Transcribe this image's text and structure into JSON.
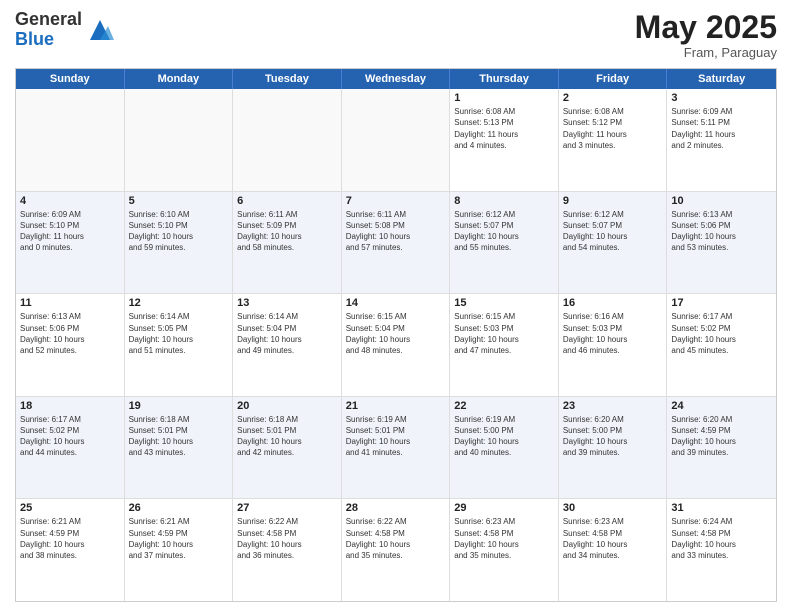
{
  "logo": {
    "general": "General",
    "blue": "Blue"
  },
  "title": "May 2025",
  "location": "Fram, Paraguay",
  "days_of_week": [
    "Sunday",
    "Monday",
    "Tuesday",
    "Wednesday",
    "Thursday",
    "Friday",
    "Saturday"
  ],
  "weeks": [
    [
      {
        "day": "",
        "info": ""
      },
      {
        "day": "",
        "info": ""
      },
      {
        "day": "",
        "info": ""
      },
      {
        "day": "",
        "info": ""
      },
      {
        "day": "1",
        "info": "Sunrise: 6:08 AM\nSunset: 5:13 PM\nDaylight: 11 hours\nand 4 minutes."
      },
      {
        "day": "2",
        "info": "Sunrise: 6:08 AM\nSunset: 5:12 PM\nDaylight: 11 hours\nand 3 minutes."
      },
      {
        "day": "3",
        "info": "Sunrise: 6:09 AM\nSunset: 5:11 PM\nDaylight: 11 hours\nand 2 minutes."
      }
    ],
    [
      {
        "day": "4",
        "info": "Sunrise: 6:09 AM\nSunset: 5:10 PM\nDaylight: 11 hours\nand 0 minutes."
      },
      {
        "day": "5",
        "info": "Sunrise: 6:10 AM\nSunset: 5:10 PM\nDaylight: 10 hours\nand 59 minutes."
      },
      {
        "day": "6",
        "info": "Sunrise: 6:11 AM\nSunset: 5:09 PM\nDaylight: 10 hours\nand 58 minutes."
      },
      {
        "day": "7",
        "info": "Sunrise: 6:11 AM\nSunset: 5:08 PM\nDaylight: 10 hours\nand 57 minutes."
      },
      {
        "day": "8",
        "info": "Sunrise: 6:12 AM\nSunset: 5:07 PM\nDaylight: 10 hours\nand 55 minutes."
      },
      {
        "day": "9",
        "info": "Sunrise: 6:12 AM\nSunset: 5:07 PM\nDaylight: 10 hours\nand 54 minutes."
      },
      {
        "day": "10",
        "info": "Sunrise: 6:13 AM\nSunset: 5:06 PM\nDaylight: 10 hours\nand 53 minutes."
      }
    ],
    [
      {
        "day": "11",
        "info": "Sunrise: 6:13 AM\nSunset: 5:06 PM\nDaylight: 10 hours\nand 52 minutes."
      },
      {
        "day": "12",
        "info": "Sunrise: 6:14 AM\nSunset: 5:05 PM\nDaylight: 10 hours\nand 51 minutes."
      },
      {
        "day": "13",
        "info": "Sunrise: 6:14 AM\nSunset: 5:04 PM\nDaylight: 10 hours\nand 49 minutes."
      },
      {
        "day": "14",
        "info": "Sunrise: 6:15 AM\nSunset: 5:04 PM\nDaylight: 10 hours\nand 48 minutes."
      },
      {
        "day": "15",
        "info": "Sunrise: 6:15 AM\nSunset: 5:03 PM\nDaylight: 10 hours\nand 47 minutes."
      },
      {
        "day": "16",
        "info": "Sunrise: 6:16 AM\nSunset: 5:03 PM\nDaylight: 10 hours\nand 46 minutes."
      },
      {
        "day": "17",
        "info": "Sunrise: 6:17 AM\nSunset: 5:02 PM\nDaylight: 10 hours\nand 45 minutes."
      }
    ],
    [
      {
        "day": "18",
        "info": "Sunrise: 6:17 AM\nSunset: 5:02 PM\nDaylight: 10 hours\nand 44 minutes."
      },
      {
        "day": "19",
        "info": "Sunrise: 6:18 AM\nSunset: 5:01 PM\nDaylight: 10 hours\nand 43 minutes."
      },
      {
        "day": "20",
        "info": "Sunrise: 6:18 AM\nSunset: 5:01 PM\nDaylight: 10 hours\nand 42 minutes."
      },
      {
        "day": "21",
        "info": "Sunrise: 6:19 AM\nSunset: 5:01 PM\nDaylight: 10 hours\nand 41 minutes."
      },
      {
        "day": "22",
        "info": "Sunrise: 6:19 AM\nSunset: 5:00 PM\nDaylight: 10 hours\nand 40 minutes."
      },
      {
        "day": "23",
        "info": "Sunrise: 6:20 AM\nSunset: 5:00 PM\nDaylight: 10 hours\nand 39 minutes."
      },
      {
        "day": "24",
        "info": "Sunrise: 6:20 AM\nSunset: 4:59 PM\nDaylight: 10 hours\nand 39 minutes."
      }
    ],
    [
      {
        "day": "25",
        "info": "Sunrise: 6:21 AM\nSunset: 4:59 PM\nDaylight: 10 hours\nand 38 minutes."
      },
      {
        "day": "26",
        "info": "Sunrise: 6:21 AM\nSunset: 4:59 PM\nDaylight: 10 hours\nand 37 minutes."
      },
      {
        "day": "27",
        "info": "Sunrise: 6:22 AM\nSunset: 4:58 PM\nDaylight: 10 hours\nand 36 minutes."
      },
      {
        "day": "28",
        "info": "Sunrise: 6:22 AM\nSunset: 4:58 PM\nDaylight: 10 hours\nand 35 minutes."
      },
      {
        "day": "29",
        "info": "Sunrise: 6:23 AM\nSunset: 4:58 PM\nDaylight: 10 hours\nand 35 minutes."
      },
      {
        "day": "30",
        "info": "Sunrise: 6:23 AM\nSunset: 4:58 PM\nDaylight: 10 hours\nand 34 minutes."
      },
      {
        "day": "31",
        "info": "Sunrise: 6:24 AM\nSunset: 4:58 PM\nDaylight: 10 hours\nand 33 minutes."
      }
    ]
  ]
}
